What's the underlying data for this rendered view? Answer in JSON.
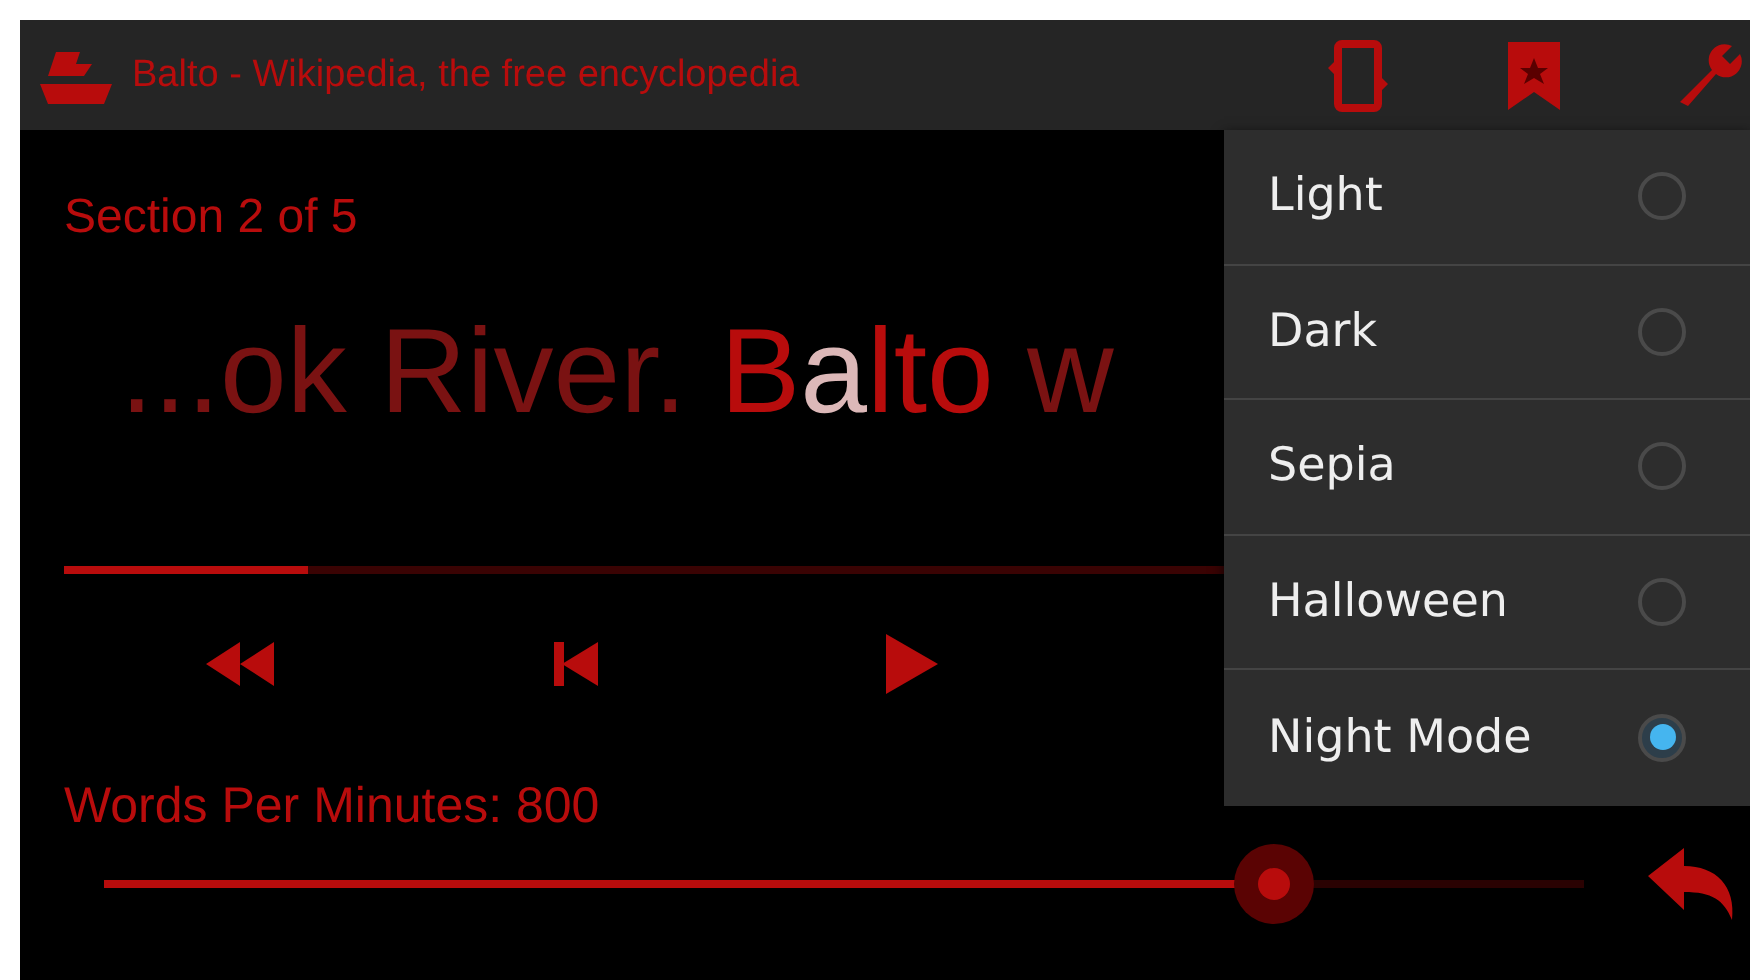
{
  "app_bar": {
    "title": "Balto - Wikipedia, the free encyclopedia"
  },
  "reader": {
    "section": "Section 2 of 5",
    "segments": [
      {
        "kind": "context",
        "text": "...ok River. "
      },
      {
        "kind": "word",
        "text": "B"
      },
      {
        "kind": "focus",
        "text": "a"
      },
      {
        "kind": "word",
        "text": "lto"
      },
      {
        "kind": "context",
        "text": " w"
      }
    ],
    "progress": {
      "level": 0.15
    }
  },
  "speed": {
    "label": "Words Per Minutes: 800",
    "level": 0.79
  },
  "theme_menu": [
    {
      "label": "Light",
      "selected": false
    },
    {
      "label": "Dark",
      "selected": false
    },
    {
      "label": "Sepia",
      "selected": false
    },
    {
      "label": "Halloween",
      "selected": false
    },
    {
      "label": "Night Mode",
      "selected": true
    }
  ]
}
